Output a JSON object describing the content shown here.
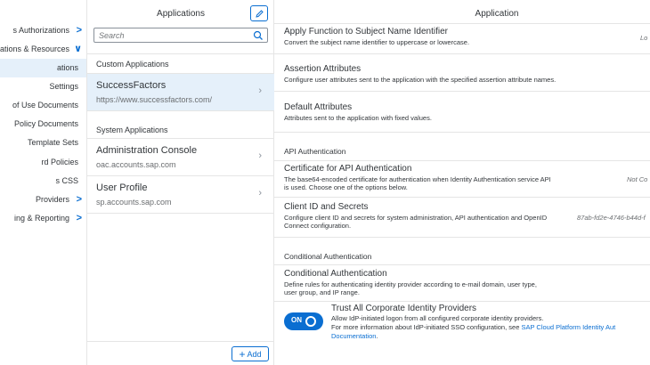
{
  "nav": {
    "items": [
      {
        "label": "s Authorizations",
        "chevron": ">",
        "active": false
      },
      {
        "label": "ations & Resources",
        "chevron": "∨",
        "active": false
      },
      {
        "label": "ations",
        "chevron": "",
        "active": true
      },
      {
        "label": "Settings",
        "chevron": "",
        "active": false
      },
      {
        "label": "of Use Documents",
        "chevron": "",
        "active": false
      },
      {
        "label": "Policy Documents",
        "chevron": "",
        "active": false
      },
      {
        "label": "Template Sets",
        "chevron": "",
        "active": false
      },
      {
        "label": "rd Policies",
        "chevron": "",
        "active": false
      },
      {
        "label": "s CSS",
        "chevron": "",
        "active": false
      },
      {
        "label": "Providers",
        "chevron": ">",
        "active": false
      },
      {
        "label": "ing & Reporting",
        "chevron": ">",
        "active": false
      }
    ]
  },
  "master": {
    "title": "Applications",
    "search_placeholder": "Search",
    "custom_header": "Custom Applications",
    "system_header": "System Applications",
    "custom_apps": [
      {
        "name": "SuccessFactors",
        "url": "https://www.successfactors.com/"
      }
    ],
    "system_apps": [
      {
        "name": "Administration Console",
        "url": "oac.accounts.sap.com"
      },
      {
        "name": "User Profile",
        "url": "sp.accounts.sap.com"
      }
    ],
    "add_label": "Add"
  },
  "detail": {
    "title": "Application",
    "apply_function": {
      "title": "Apply Function to Subject Name Identifier",
      "desc": "Convert the subject name identifier to uppercase or lowercase.",
      "value": "Lo"
    },
    "assertion_attributes": {
      "title": "Assertion Attributes",
      "desc": "Configure user attributes sent to the application with the specified assertion attribute names."
    },
    "default_attributes": {
      "title": "Default Attributes",
      "desc": "Attributes sent to the application with fixed values."
    },
    "api_auth_header": "API Authentication",
    "certificate": {
      "title": "Certificate for API Authentication",
      "desc": "The base64-encoded certificate for authentication when Identity Authentication service API is used. Choose one of the options below.",
      "value": "Not Co"
    },
    "client_id": {
      "title": "Client ID and Secrets",
      "desc": "Configure client ID and secrets for system administration, API authentication and OpenID Connect configuration.",
      "value": "87ab-fd2e-4746-b44d-f"
    },
    "conditional_header": "Conditional Authentication",
    "conditional": {
      "title": "Conditional Authentication",
      "desc": "Define rules for authenticating identity provider according to e-mail domain, user type, user group, and IP range."
    },
    "trust": {
      "toggle_label": "ON",
      "title": "Trust All Corporate Identity Providers",
      "desc1": "Allow IdP-initiated logon from all configured corporate identity providers.",
      "desc2_prefix": "For more information about IdP-initiated SSO configuration, see ",
      "desc2_link": "SAP Cloud Platform Identity Aut",
      "desc3_link": "Documentation",
      "desc3_suffix": "."
    }
  },
  "colors": {
    "accent": "#0a6ed1",
    "selected": "#e5f0fa",
    "text": "#32363a"
  }
}
